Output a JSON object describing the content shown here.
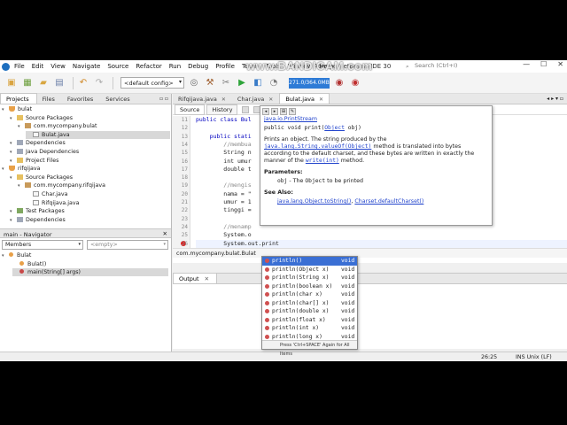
{
  "window": {
    "title": "Apache NetBeans IDE 30",
    "watermark": "www.BANDICAM.com",
    "search_placeholder": "Search (Ctrl+I)",
    "controls": [
      "—",
      "☐",
      "✕"
    ]
  },
  "menu": [
    "File",
    "Edit",
    "View",
    "Navigate",
    "Source",
    "Refactor",
    "Run",
    "Debug",
    "Profile",
    "Team",
    "Tools",
    "Window",
    "Help"
  ],
  "toolbar": {
    "config": "<default config>",
    "memory": "271.0/364.0MB"
  },
  "projects_panel": {
    "tabs": [
      "Projects",
      "Files",
      "Favorites",
      "Services"
    ],
    "tree": [
      {
        "label": "bulat",
        "depth": 0,
        "icon": "project-cup-icon"
      },
      {
        "label": "Source Packages",
        "depth": 1,
        "icon": "folder-icon"
      },
      {
        "label": "com.mycompany.bulat",
        "depth": 2,
        "icon": "package-icon"
      },
      {
        "label": "Bulat.java",
        "depth": 3,
        "icon": "java-file-icon",
        "selected": true
      },
      {
        "label": "Dependencies",
        "depth": 1,
        "icon": "library-icon"
      },
      {
        "label": "Java Dependencies",
        "depth": 1,
        "icon": "library-icon"
      },
      {
        "label": "Project Files",
        "depth": 1,
        "icon": "folder-icon"
      },
      {
        "label": "rifqijava",
        "depth": 0,
        "icon": "project-cup-icon"
      },
      {
        "label": "Source Packages",
        "depth": 1,
        "icon": "folder-icon"
      },
      {
        "label": "com.mycompany.rifqijava",
        "depth": 2,
        "icon": "package-icon"
      },
      {
        "label": "Char.java",
        "depth": 3,
        "icon": "java-file-icon"
      },
      {
        "label": "Rifqijava.java",
        "depth": 3,
        "icon": "java-file-icon"
      },
      {
        "label": "Test Packages",
        "depth": 1,
        "icon": "test-folder-icon"
      },
      {
        "label": "Dependencies",
        "depth": 1,
        "icon": "library-icon"
      }
    ]
  },
  "navigator_panel": {
    "title": "main - Navigator",
    "filter": "Members",
    "empty": "<empty>",
    "items": [
      {
        "label": "Bulat",
        "depth": 0
      },
      {
        "label": "Bulat()",
        "depth": 1
      },
      {
        "label": "main(String[] args)",
        "depth": 1,
        "selected": true
      }
    ]
  },
  "editor": {
    "tabs": [
      {
        "label": "Rifqijava.java",
        "active": false
      },
      {
        "label": "Char.java",
        "active": false
      },
      {
        "label": "Bulat.java",
        "active": true
      }
    ],
    "source_tab": "Source",
    "history_tab": "History",
    "line_numbers": [
      "11",
      "12",
      "13",
      "14",
      "15",
      "16",
      "17",
      "18",
      "19",
      "20",
      "21",
      "22",
      "23",
      "24",
      "25",
      "26"
    ],
    "lines": [
      "public class Bul",
      "",
      "    public stati",
      "        //membua",
      "        String n",
      "        int umur",
      "        double t",
      "",
      "        //mengis",
      "        nama = \"",
      "        umur = 1",
      "        tinggi =",
      "",
      "        //menamp",
      "        System.o",
      "        System.out.print"
    ],
    "breadcrumb": "com.mycompany.bulat.Bulat"
  },
  "javadoc": {
    "title": "java.io.PrintStream",
    "sig_prefix": "public void print(",
    "sig_type": "Object",
    "sig_suffix": " obj)",
    "desc_1": "Prints an object. The string produced by the ",
    "desc_link1": "java.lang.String.valueOf(Object)",
    "desc_2": " method is translated into bytes according to the default charset, and these bytes are written in exactly the manner of the ",
    "desc_link2": "write(int)",
    "desc_3": " method.",
    "params_label": "Parameters:",
    "param_name": "obj",
    "param_desc": " - The ",
    "param_type": "Object",
    "param_desc2": " to be printed",
    "see_also_label": "See Also:",
    "see_also_1": "java.lang.Object.toString()",
    "see_also_sep": ", ",
    "see_also_2": "Charset.defaultCharset()"
  },
  "completion": {
    "items": [
      {
        "name": "println()",
        "ret": "void",
        "selected": true
      },
      {
        "name": "println(Object x)",
        "ret": "void"
      },
      {
        "name": "println(String x)",
        "ret": "void"
      },
      {
        "name": "println(boolean x)",
        "ret": "void"
      },
      {
        "name": "println(char x)",
        "ret": "void"
      },
      {
        "name": "println(char[] x)",
        "ret": "void"
      },
      {
        "name": "println(double x)",
        "ret": "void"
      },
      {
        "name": "println(float x)",
        "ret": "void"
      },
      {
        "name": "println(int x)",
        "ret": "void"
      },
      {
        "name": "println(long x)",
        "ret": "void"
      }
    ],
    "hint": "Press 'Ctrl+SPACE' Again for All Items"
  },
  "output": {
    "tab": "Output"
  },
  "status": {
    "position": "26:25",
    "mode": "INS Unix (LF)"
  }
}
